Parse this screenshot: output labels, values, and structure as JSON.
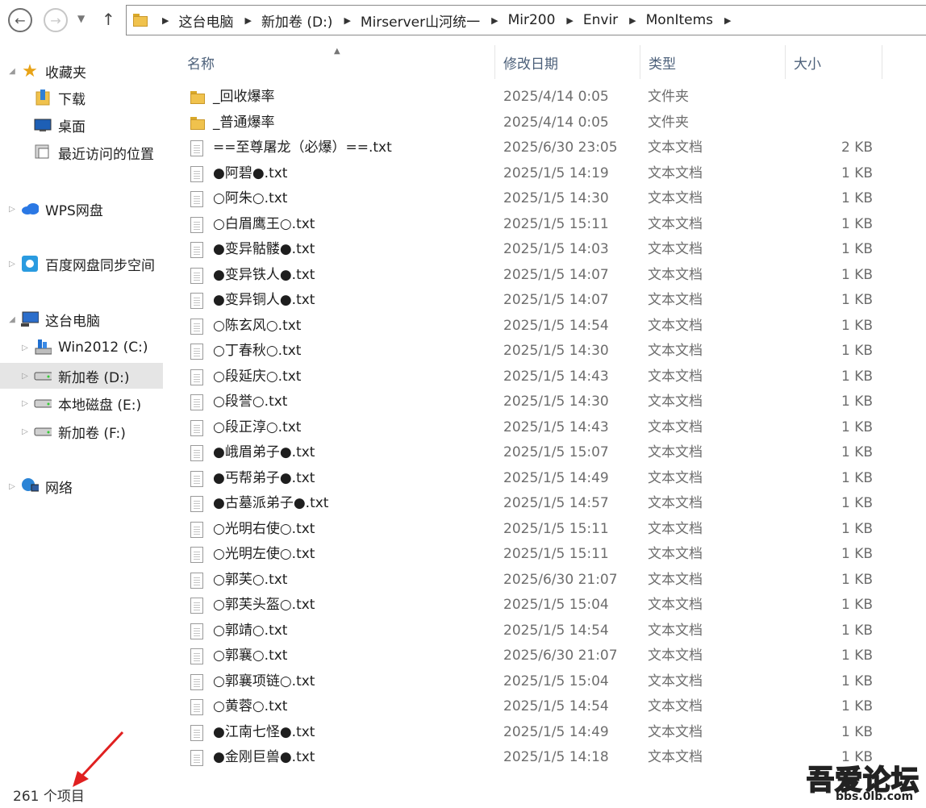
{
  "toolbar": {
    "back_icon": "back-arrow-icon",
    "forward_icon": "forward-arrow-icon",
    "up_icon": "up-arrow-icon"
  },
  "breadcrumb": [
    "这台电脑",
    "新加卷 (D:)",
    "Mirserver山河统一",
    "Mir200",
    "Envir",
    "MonItems"
  ],
  "sidebar": {
    "items": [
      {
        "label": "收藏夹",
        "icon": "star-icon",
        "level": 0,
        "expander": "◢"
      },
      {
        "label": "下载",
        "icon": "downloads-folder-icon",
        "level": 1
      },
      {
        "label": "桌面",
        "icon": "desktop-icon",
        "level": 1
      },
      {
        "label": "最近访问的位置",
        "icon": "recent-places-icon",
        "level": 1
      },
      {
        "label": "WPS网盘",
        "icon": "cloud-icon",
        "level": 0,
        "expander": "▷"
      },
      {
        "label": "百度网盘同步空间",
        "icon": "baidu-netdisk-icon",
        "level": 0,
        "expander": "▷"
      },
      {
        "label": "这台电脑",
        "icon": "computer-icon",
        "level": 0,
        "expander": "◢"
      },
      {
        "label": "Win2012 (C:)",
        "icon": "system-drive-icon",
        "level": 1,
        "expander": "▷"
      },
      {
        "label": "新加卷 (D:)",
        "icon": "drive-icon",
        "level": 1,
        "expander": "▷",
        "selected": true
      },
      {
        "label": "本地磁盘 (E:)",
        "icon": "drive-icon",
        "level": 1,
        "expander": "▷"
      },
      {
        "label": "新加卷 (F:)",
        "icon": "drive-icon",
        "level": 1,
        "expander": "▷"
      },
      {
        "label": "网络",
        "icon": "network-icon",
        "level": 0,
        "expander": "▷"
      }
    ]
  },
  "columns": {
    "name": "名称",
    "date": "修改日期",
    "type": "类型",
    "size": "大小"
  },
  "files": [
    {
      "name": "_回收爆率",
      "date": "2025/4/14 0:05",
      "type": "文件夹",
      "size": "",
      "kind": "folder"
    },
    {
      "name": "_普通爆率",
      "date": "2025/4/14 0:05",
      "type": "文件夹",
      "size": "",
      "kind": "folder"
    },
    {
      "name": "==至尊屠龙（必爆）==.txt",
      "date": "2025/6/30 23:05",
      "type": "文本文档",
      "size": "2 KB",
      "kind": "txt"
    },
    {
      "name": "●阿碧●.txt",
      "date": "2025/1/5 14:19",
      "type": "文本文档",
      "size": "1 KB",
      "kind": "txt"
    },
    {
      "name": "○阿朱○.txt",
      "date": "2025/1/5 14:30",
      "type": "文本文档",
      "size": "1 KB",
      "kind": "txt"
    },
    {
      "name": "○白眉鹰王○.txt",
      "date": "2025/1/5 15:11",
      "type": "文本文档",
      "size": "1 KB",
      "kind": "txt"
    },
    {
      "name": "●变异骷髅●.txt",
      "date": "2025/1/5 14:03",
      "type": "文本文档",
      "size": "1 KB",
      "kind": "txt"
    },
    {
      "name": "●变异铁人●.txt",
      "date": "2025/1/5 14:07",
      "type": "文本文档",
      "size": "1 KB",
      "kind": "txt"
    },
    {
      "name": "●变异铜人●.txt",
      "date": "2025/1/5 14:07",
      "type": "文本文档",
      "size": "1 KB",
      "kind": "txt"
    },
    {
      "name": "○陈玄风○.txt",
      "date": "2025/1/5 14:54",
      "type": "文本文档",
      "size": "1 KB",
      "kind": "txt"
    },
    {
      "name": "○丁春秋○.txt",
      "date": "2025/1/5 14:30",
      "type": "文本文档",
      "size": "1 KB",
      "kind": "txt"
    },
    {
      "name": "○段延庆○.txt",
      "date": "2025/1/5 14:43",
      "type": "文本文档",
      "size": "1 KB",
      "kind": "txt"
    },
    {
      "name": "○段誉○.txt",
      "date": "2025/1/5 14:30",
      "type": "文本文档",
      "size": "1 KB",
      "kind": "txt"
    },
    {
      "name": "○段正淳○.txt",
      "date": "2025/1/5 14:43",
      "type": "文本文档",
      "size": "1 KB",
      "kind": "txt"
    },
    {
      "name": "●峨眉弟子●.txt",
      "date": "2025/1/5 15:07",
      "type": "文本文档",
      "size": "1 KB",
      "kind": "txt"
    },
    {
      "name": "●丐帮弟子●.txt",
      "date": "2025/1/5 14:49",
      "type": "文本文档",
      "size": "1 KB",
      "kind": "txt"
    },
    {
      "name": "●古墓派弟子●.txt",
      "date": "2025/1/5 14:57",
      "type": "文本文档",
      "size": "1 KB",
      "kind": "txt"
    },
    {
      "name": "○光明右使○.txt",
      "date": "2025/1/5 15:11",
      "type": "文本文档",
      "size": "1 KB",
      "kind": "txt"
    },
    {
      "name": "○光明左使○.txt",
      "date": "2025/1/5 15:11",
      "type": "文本文档",
      "size": "1 KB",
      "kind": "txt"
    },
    {
      "name": "○郭芙○.txt",
      "date": "2025/6/30 21:07",
      "type": "文本文档",
      "size": "1 KB",
      "kind": "txt"
    },
    {
      "name": "○郭芙头盔○.txt",
      "date": "2025/1/5 15:04",
      "type": "文本文档",
      "size": "1 KB",
      "kind": "txt"
    },
    {
      "name": "○郭靖○.txt",
      "date": "2025/1/5 14:54",
      "type": "文本文档",
      "size": "1 KB",
      "kind": "txt"
    },
    {
      "name": "○郭襄○.txt",
      "date": "2025/6/30 21:07",
      "type": "文本文档",
      "size": "1 KB",
      "kind": "txt"
    },
    {
      "name": "○郭襄项链○.txt",
      "date": "2025/1/5 15:04",
      "type": "文本文档",
      "size": "1 KB",
      "kind": "txt"
    },
    {
      "name": "○黄蓉○.txt",
      "date": "2025/1/5 14:54",
      "type": "文本文档",
      "size": "1 KB",
      "kind": "txt"
    },
    {
      "name": "●江南七怪●.txt",
      "date": "2025/1/5 14:49",
      "type": "文本文档",
      "size": "1 KB",
      "kind": "txt"
    },
    {
      "name": "●金刚巨兽●.txt",
      "date": "2025/1/5 14:18",
      "type": "文本文档",
      "size": "1 KB",
      "kind": "txt"
    }
  ],
  "status": {
    "item_count": "261 个项目"
  },
  "watermark": {
    "main": "吾爱论坛",
    "sub": "bbs.0lb.com"
  }
}
